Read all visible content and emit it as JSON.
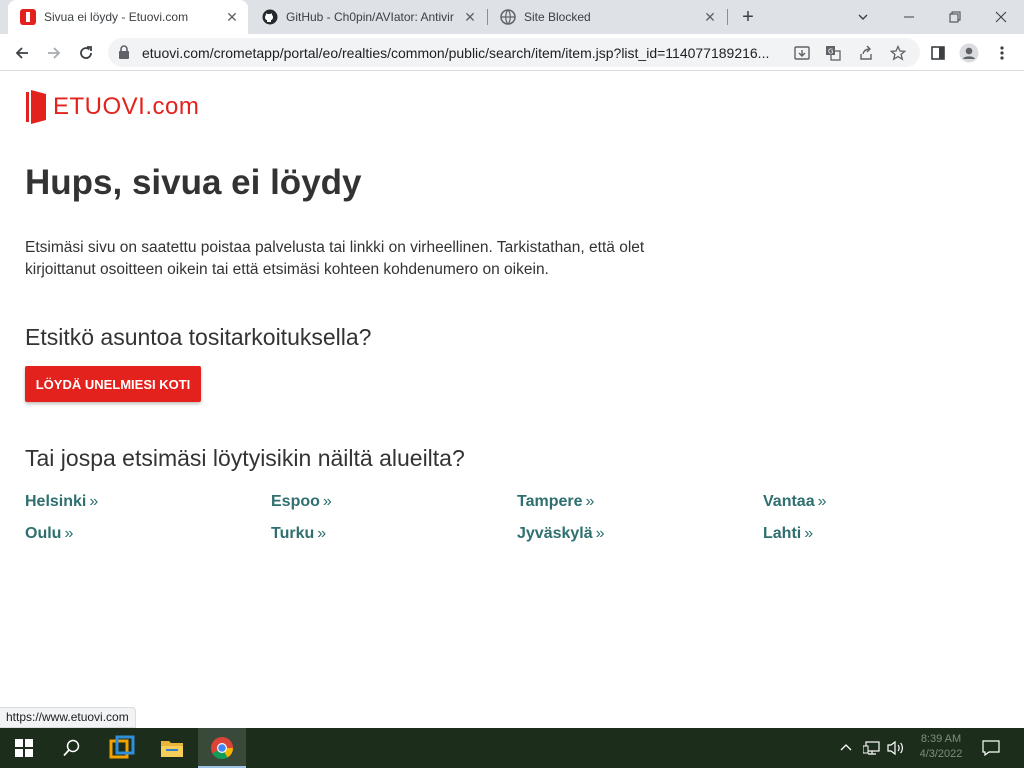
{
  "browser": {
    "tabs": [
      {
        "title": "Sivua ei löydy - Etuovi.com",
        "active": true,
        "favicon": "etuovi-favicon"
      },
      {
        "title": "GitHub - Ch0pin/AVIator: Antivir",
        "active": false,
        "favicon": "github-icon"
      },
      {
        "title": "Site Blocked",
        "active": false,
        "favicon": "globe-icon"
      }
    ],
    "close_glyph": "✕",
    "new_tab_glyph": "+",
    "url": "etuovi.com/crometapp/portal/eo/realties/common/public/search/item/item.jsp?list_id=114077189216..."
  },
  "page": {
    "logo": {
      "brand": "ETUOVI",
      "suffix": ".com"
    },
    "title": "Hups, sivua ei löydy",
    "description": "Etsimäsi sivu on saatettu poistaa palvelusta tai linkki on virheellinen. Tarkistathan, että olet kirjoittanut osoitteen oikein tai että etsimäsi kohteen kohdenumero on oikein.",
    "section1_heading": "Etsitkö asuntoa tositarkoituksella?",
    "cta_label": "LÖYDÄ UNELMIESI KOTI",
    "section2_heading": "Tai jospa etsimäsi löytyisikin näiltä alueilta?",
    "areas": [
      {
        "name": "Helsinki",
        "suffix": "»"
      },
      {
        "name": "Espoo",
        "suffix": "»"
      },
      {
        "name": "Tampere",
        "suffix": "»"
      },
      {
        "name": "Vantaa",
        "suffix": "»"
      },
      {
        "name": "Oulu",
        "suffix": "»"
      },
      {
        "name": "Turku",
        "suffix": "»"
      },
      {
        "name": "Jyväskylä",
        "suffix": "»"
      },
      {
        "name": "Lahti",
        "suffix": "»"
      }
    ],
    "status_url": "https://www.etuovi.com"
  },
  "taskbar": {
    "clock_time": "8:39 AM",
    "clock_date": "4/3/2022"
  },
  "colors": {
    "brand_red": "#e4221d",
    "link_teal": "#2f6f6f",
    "taskbar": "#1c2d1c"
  }
}
